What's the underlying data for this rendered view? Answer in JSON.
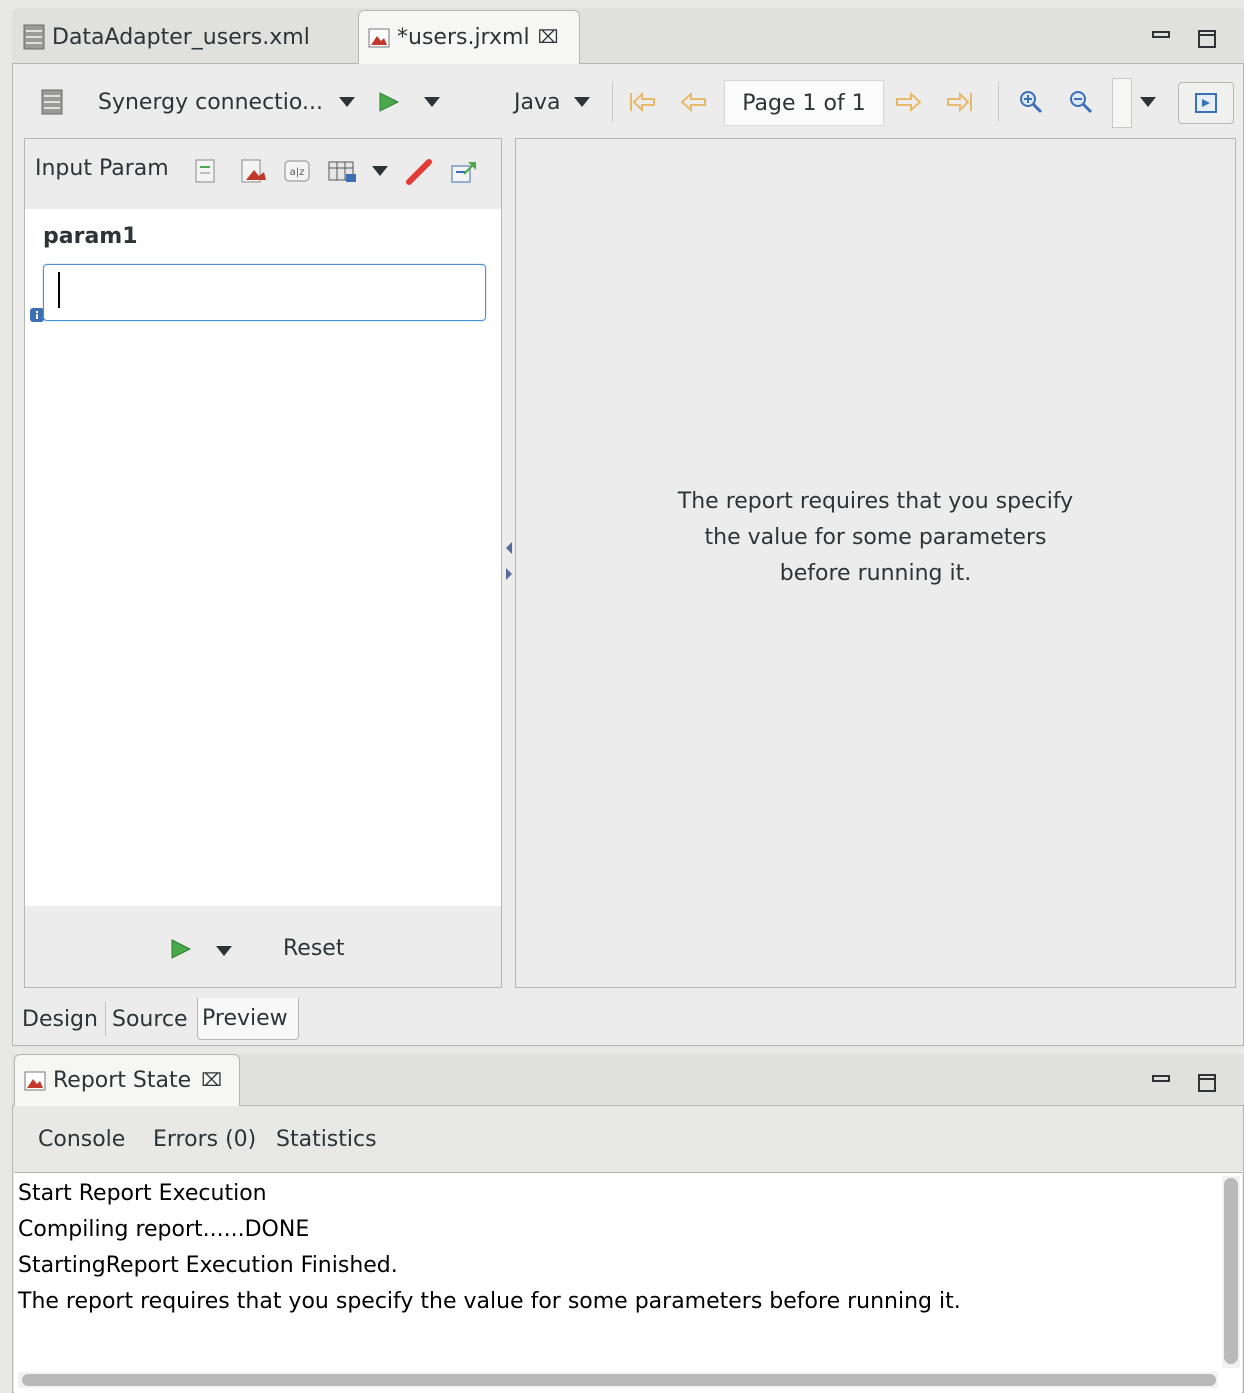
{
  "editor": {
    "tabs": [
      {
        "label": "DataAdapter_users.xml",
        "icon": "database-icon",
        "active": false
      },
      {
        "label": "*users.jrxml",
        "icon": "report-icon",
        "active": true,
        "close": "⌧"
      }
    ]
  },
  "toolbar": {
    "data_adapter": "Synergy connectio...",
    "language": "Java",
    "page_label": "Page 1 of 1"
  },
  "params_panel": {
    "title": "Input Param",
    "param_name": "param1",
    "param_value": "",
    "reset_label": "Reset"
  },
  "preview": {
    "message_lines": [
      "The report requires that you specify",
      "the value for some parameters",
      "before running it."
    ]
  },
  "editor_tabs": [
    {
      "label": "Design",
      "active": false
    },
    {
      "label": "Source",
      "active": false
    },
    {
      "label": "Preview",
      "active": true
    }
  ],
  "report_state": {
    "title": "Report State",
    "close": "⌧",
    "subtabs": [
      "Console",
      "Errors (0)",
      "Statistics"
    ],
    "console_lines": [
      "Start Report Execution",
      "Compiling report......DONE",
      "StartingReport Execution Finished.",
      "The report requires that you specify the value for some parameters before running it."
    ]
  },
  "colors": {
    "run_green": "#4aa94a",
    "nav_arrow": "#f0c674",
    "focus_blue": "#4a90d9"
  }
}
